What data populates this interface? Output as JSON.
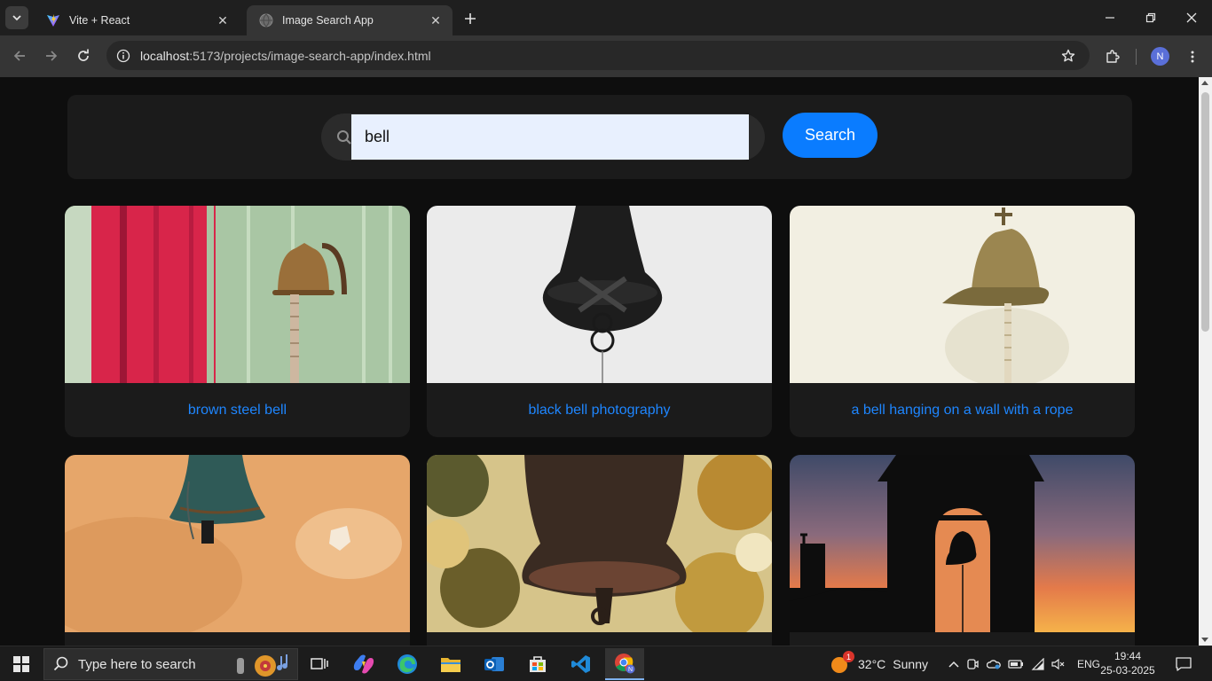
{
  "browser": {
    "tabs": [
      {
        "title": "Vite + React",
        "active": false
      },
      {
        "title": "Image Search App",
        "active": true
      }
    ],
    "url_host": "localhost",
    "url_rest": ":5173/projects/image-search-app/index.html",
    "profile_initial": "N"
  },
  "search": {
    "value": "bell",
    "button_label": "Search"
  },
  "results": [
    {
      "caption": "brown steel bell"
    },
    {
      "caption": "black bell photography"
    },
    {
      "caption": "a bell hanging on a wall with a rope"
    },
    {
      "caption": ""
    },
    {
      "caption": ""
    },
    {
      "caption": ""
    }
  ],
  "taskbar": {
    "search_placeholder": "Type here to search",
    "weather_badge": "1",
    "weather_temp": "32°C",
    "weather_condition": "Sunny",
    "language": "ENG",
    "time": "19:44",
    "date": "25-03-2025"
  },
  "colors": {
    "accent": "#0a7cff",
    "caption_link": "#1e86ff",
    "page_bg": "#0e0e0e",
    "card_bg": "#1b1b1b"
  }
}
